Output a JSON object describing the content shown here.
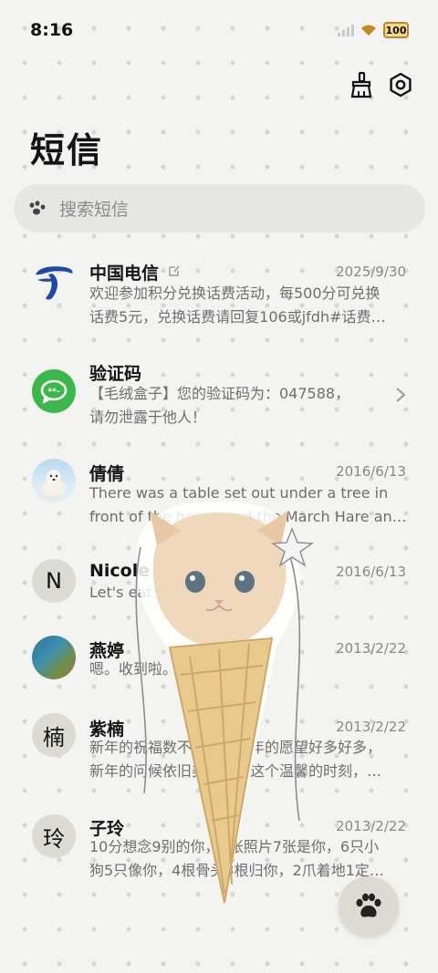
{
  "status": {
    "time": "8:16",
    "battery": "100"
  },
  "header": {
    "title": "短信"
  },
  "search": {
    "placeholder": "搜索短信"
  },
  "conversations": [
    {
      "name": "中国电信",
      "date": "2025/9/30",
      "preview_lines": [
        "欢迎参加积分兑换话费活动，每500分可兑换",
        "话费5元，兑换话费请回复106或jfdh#话费…"
      ],
      "avatar": "china-telecom-logo"
    },
    {
      "name": "验证码",
      "date": "",
      "preview_lines": [
        "【毛绒盒子】您的验证码为：047588，",
        "请勿泄露于他人！"
      ],
      "avatar": "message-bubble-icon"
    },
    {
      "name": "倩倩",
      "date": "2016/6/13",
      "preview_lines": [
        "There was a table set out under a tree in",
        "front of the house,and the March Hare an…"
      ],
      "avatar": "polar-bear-photo"
    },
    {
      "name": "Nicole",
      "date": "2016/6/13",
      "preview_lines": [
        "Let's eat out,shall we?"
      ],
      "avatar_letter": "N"
    },
    {
      "name": "燕婷",
      "date": "2013/2/22",
      "preview_lines": [
        "嗯。收到啦。同乐同乐。"
      ],
      "avatar": "landscape-photo"
    },
    {
      "name": "紫楠",
      "date": "2013/2/22",
      "preview_lines": [
        "新年的祝福数不胜数，新年的愿望好多好多，",
        "新年的问候依旧美好，在这个温馨的时刻，…"
      ],
      "avatar_letter": "楠"
    },
    {
      "name": "子玲",
      "date": "2013/2/22",
      "preview_lines": [
        "10分想念9别的你，8张照片7张是你，6只小",
        "狗5只像你，4根骨头3根归你，2爪着地1定…"
      ],
      "avatar_letter": "玲"
    }
  ],
  "colors": {
    "accent": "#2f9e2f",
    "telecom_blue": "#1c4aa6"
  }
}
